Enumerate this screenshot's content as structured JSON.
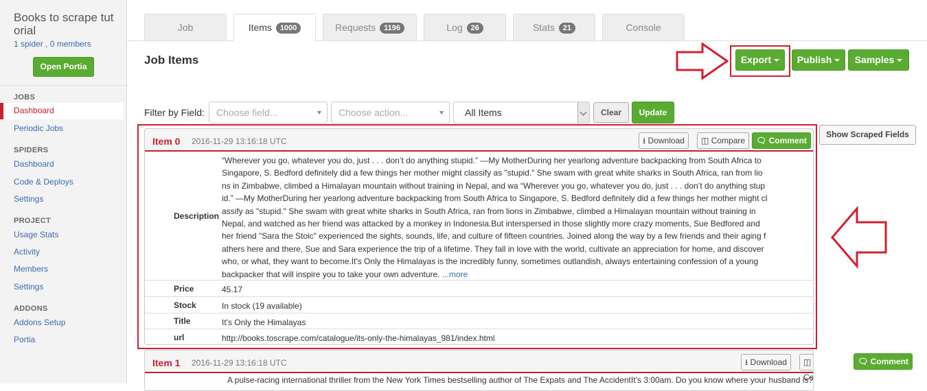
{
  "sidebar": {
    "project_title": "Books to scrape tut orial",
    "project_sub": "1 spider , 0 members",
    "portia_button": "Open Portia",
    "sections": [
      {
        "heading": "JOBS",
        "items": [
          "Dashboard",
          "Periodic Jobs"
        ]
      },
      {
        "heading": "SPIDERS",
        "items": [
          "Dashboard",
          "Code & Deploys",
          "Settings"
        ]
      },
      {
        "heading": "PROJECT",
        "items": [
          "Usage Stats",
          "Activity",
          "Members",
          "Settings"
        ]
      },
      {
        "heading": "ADDONS",
        "items": [
          "Addons Setup",
          "Portia"
        ]
      }
    ],
    "active_item": "Dashboard"
  },
  "tabs": [
    {
      "label": "Job",
      "badge": ""
    },
    {
      "label": "Items",
      "badge": "1000"
    },
    {
      "label": "Requests",
      "badge": "1196"
    },
    {
      "label": "Log",
      "badge": "26"
    },
    {
      "label": "Stats",
      "badge": "21"
    },
    {
      "label": "Console",
      "badge": ""
    }
  ],
  "active_tab": "Items",
  "page_title": "Job Items",
  "actions": {
    "export": "Export",
    "publish": "Publish",
    "samples": "Samples"
  },
  "filter": {
    "label": "Filter by Field:",
    "field_placeholder": "Choose field...",
    "action_placeholder": "Choose action...",
    "scope_value": "All Items",
    "clear": "Clear",
    "update": "Update"
  },
  "show_scraped_fields": "Show Scraped Fields",
  "item_buttons": {
    "download": "Download",
    "compare": "Compare",
    "comment": "Comment"
  },
  "items": [
    {
      "title": "Item 0",
      "timestamp": "2016-11-29 13:16:18 UTC",
      "fields": {
        "description_label": "Description",
        "description_lines": [
          "“Wherever you go, whatever you do, just . . . don’t do anything stupid.” —My MotherDuring her yearlong adventure backpacking from South Africa to",
          "Singapore, S. Bedford definitely did a few things her mother might classify as \"stupid.\" She swam with great white sharks in South Africa, ran from lio",
          "ns in Zimbabwe, climbed a Himalayan mountain without training in Nepal, and wa “Wherever you go, whatever you do, just . . . don’t do anything stup",
          "id.” —My MotherDuring her yearlong adventure backpacking from South Africa to Singapore, S. Bedford definitely did a few things her mother might cl",
          "assify as \"stupid.\" She swam with great white sharks in South Africa, ran from lions in Zimbabwe, climbed a Himalayan mountain without training in",
          "Nepal, and watched as her friend was attacked by a monkey in Indonesia.But interspersed in those slightly more crazy moments, Sue Bedfored and",
          "her friend \"Sara the Stoic\" experienced the sights, sounds, life, and culture of fifteen countries. Joined along the way by a few friends and their aging f",
          "athers here and there, Sue and Sara experience the trip of a lifetime. They fall in love with the world, cultivate an appreciation for home, and discover",
          "who, or what, they want to become.It's Only the Himalayas is the incredibly funny, sometimes outlandish, always entertaining confession of a young",
          "backpacker that will inspire you to take your own adventure."
        ],
        "more": "...more",
        "price_label": "Price",
        "price": "45.17",
        "stock_label": "Stock",
        "stock": "In stock (19 available)",
        "title_label": "Title",
        "title": "It's Only the Himalayas",
        "url_label": "url",
        "url": "http://books.toscrape.com/catalogue/its-only-the-himalayas_981/index.html"
      }
    },
    {
      "title": "Item 1",
      "timestamp": "2016-11-29 13:16:18 UTC",
      "first_line": "A pulse-racing international thriller from the New York Times bestselling author of The Expats and The AccidentIt’s 3:00am. Do you know where your husband is?Meet Will R"
    }
  ]
}
